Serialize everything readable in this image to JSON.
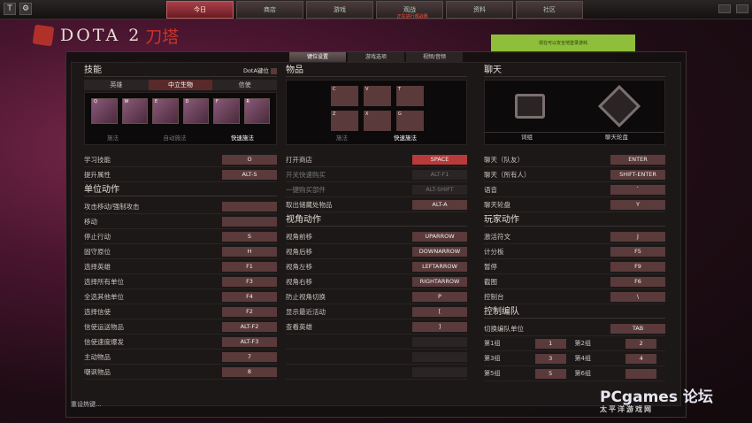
{
  "topbar": {
    "tabs": [
      "今日",
      "商店",
      "游戏",
      "观战",
      "资料",
      "社区"
    ],
    "active_index": 0,
    "sub_text": "正在进行观战赛",
    "close_label": "T"
  },
  "logo": {
    "text": "DOTA 2",
    "cn": "刀塔"
  },
  "notice": "现在可以安全地登录游戏",
  "settings_tabs": [
    "键位设置",
    "游戏选项",
    "视频/音频"
  ],
  "skills": {
    "title": "技能",
    "dota_key": "DotA键位",
    "subtabs": [
      "英雄",
      "中立生物",
      "信使"
    ],
    "slots": [
      "Q",
      "W",
      "E",
      "D",
      "F",
      "R"
    ],
    "modes": [
      "施法",
      "自动施法",
      "快速施法"
    ]
  },
  "items": {
    "title": "物品",
    "slots": [
      "C",
      "V",
      "T",
      "Z",
      "X",
      "G"
    ],
    "modes": [
      "施法",
      "快速施法"
    ]
  },
  "chat": {
    "title": "聊天",
    "labels": [
      "词组",
      "聊天轮盘"
    ]
  },
  "col1_top": [
    {
      "label": "学习技能",
      "key": "O"
    },
    {
      "label": "提升属性",
      "key": "ALT-S"
    }
  ],
  "unit_actions": {
    "title": "单位动作",
    "rows": [
      {
        "label": "攻击移动/强制攻击",
        "key": ""
      },
      {
        "label": "移动",
        "key": ""
      },
      {
        "label": "停止行动",
        "key": "S"
      },
      {
        "label": "固守原位",
        "key": "H"
      },
      {
        "label": "选择英雄",
        "key": "F1"
      },
      {
        "label": "选择所有单位",
        "key": "F3"
      },
      {
        "label": "全选其他单位",
        "key": "F4"
      },
      {
        "label": "选择信使",
        "key": "F2"
      },
      {
        "label": "信使运送物品",
        "key": "ALT-F2"
      },
      {
        "label": "信使速度爆发",
        "key": "ALT-F3"
      },
      {
        "label": "主动物品",
        "key": "7"
      },
      {
        "label": "嘲讽物品",
        "key": "8"
      }
    ]
  },
  "col2_top": [
    {
      "label": "打开商店",
      "key": "SPACE"
    },
    {
      "label": "开关快速购买",
      "key": "ALT-F1"
    },
    {
      "label": "一键购买部件",
      "key": "ALT-SHIFT"
    },
    {
      "label": "取出储藏处物品",
      "key": "ALT-A"
    }
  ],
  "camera": {
    "title": "视角动作",
    "rows": [
      {
        "label": "视角前移",
        "key": "UPARROW"
      },
      {
        "label": "视角后移",
        "key": "DOWNARROW"
      },
      {
        "label": "视角左移",
        "key": "LEFTARROW"
      },
      {
        "label": "视角右移",
        "key": "RIGHTARROW"
      },
      {
        "label": "防止视角切换",
        "key": "P"
      },
      {
        "label": "显示最近活动",
        "key": "["
      },
      {
        "label": "查看英雄",
        "key": "]"
      },
      {
        "label": "",
        "key": ""
      },
      {
        "label": "",
        "key": ""
      },
      {
        "label": "",
        "key": ""
      }
    ]
  },
  "col3_top": [
    {
      "label": "聊天（队友）",
      "key": "ENTER"
    },
    {
      "label": "聊天（所有人）",
      "key": "SHIFT-ENTER"
    },
    {
      "label": "语音",
      "key": "`"
    },
    {
      "label": "聊天轮盘",
      "key": "Y"
    }
  ],
  "player": {
    "title": "玩家动作",
    "rows": [
      {
        "label": "激活符文",
        "key": "J"
      },
      {
        "label": "计分板",
        "key": "F5"
      },
      {
        "label": "暂停",
        "key": "F9"
      },
      {
        "label": "截图",
        "key": "F6"
      },
      {
        "label": "控制台",
        "key": "\\"
      }
    ]
  },
  "control": {
    "title": "控制编队",
    "select": {
      "label": "切换编队单位",
      "key": "TAB"
    },
    "groups": [
      [
        "第1组",
        "1",
        "第2组",
        "2"
      ],
      [
        "第3组",
        "3",
        "第4组",
        "4"
      ],
      [
        "第5组",
        "5",
        "第6组",
        ""
      ]
    ]
  },
  "footer": "重设热键...",
  "watermark": {
    "main": "PCgames 论坛",
    "sub": "太平洋游戏网"
  }
}
